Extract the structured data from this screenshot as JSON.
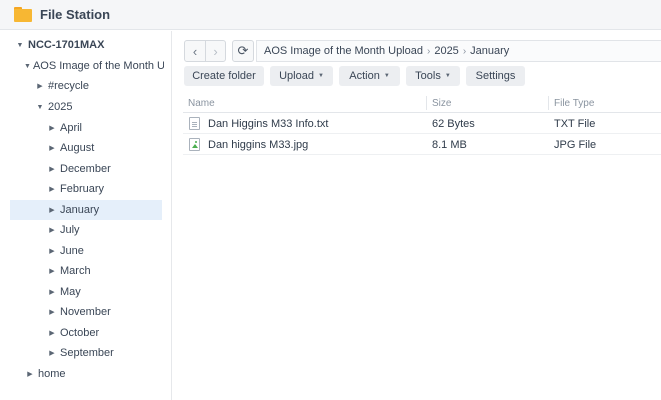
{
  "app": {
    "title": "File Station",
    "icon": "folder-icon"
  },
  "tree": {
    "root": "NCC-1701MAX",
    "share": "AOS Image of the Month Upload",
    "recycle": "#recycle",
    "year": "2025",
    "months": [
      "April",
      "August",
      "December",
      "February",
      "January",
      "July",
      "June",
      "March",
      "May",
      "November",
      "October",
      "September"
    ],
    "selected": "January",
    "home": "home"
  },
  "nav": {
    "back_icon": "‹",
    "forward_icon": "›",
    "refresh_icon": "⟳"
  },
  "breadcrumb": [
    "AOS Image of the Month Upload",
    "2025",
    "January"
  ],
  "actions": {
    "create_folder": "Create folder",
    "upload": "Upload",
    "action": "Action",
    "tools": "Tools",
    "settings": "Settings"
  },
  "list": {
    "columns": {
      "name": "Name",
      "size": "Size",
      "type": "File Type"
    },
    "rows": [
      {
        "name": "Dan Higgins M33 Info.txt",
        "size": "62 Bytes",
        "type": "TXT File",
        "icon": "text-file-icon"
      },
      {
        "name": "Dan higgins M33.jpg",
        "size": "8.1 MB",
        "type": "JPG File",
        "icon": "image-file-icon"
      }
    ]
  },
  "colors": {
    "accent_selected": "#e5effa",
    "folder": "#f7b733"
  }
}
